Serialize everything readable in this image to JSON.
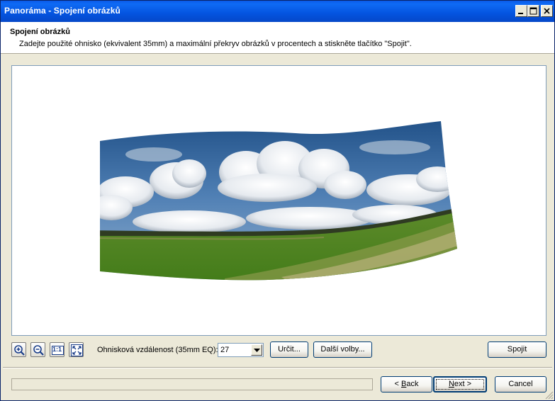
{
  "window": {
    "title": "Panoráma - Spojení obrázků"
  },
  "header": {
    "title": "Spojení obrázků",
    "description": "Zadejte použité ohnisko (ekvivalent 35mm) a maximální překryv obrázků v procentech a stiskněte tlačítko \"Spojit\"."
  },
  "toolbar": {
    "zoom_in_icon": "zoom-in-icon",
    "zoom_out_icon": "zoom-out-icon",
    "actual_size_label": "1:1",
    "fit_icon": "fit-to-window-icon",
    "focal_label": "Ohnisková vzdálenost (35mm EQ):",
    "focal_value": "27",
    "determine_label": "Určit...",
    "more_options_label": "Další volby...",
    "join_label": "Spojit"
  },
  "footer": {
    "back_prefix": "< ",
    "back_key": "B",
    "back_rest": "ack",
    "next_key": "N",
    "next_rest": "ext >",
    "cancel_label": "Cancel"
  }
}
